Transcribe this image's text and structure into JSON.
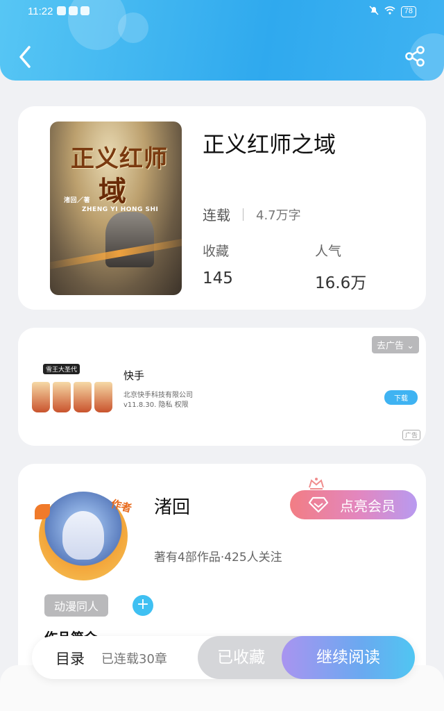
{
  "status_bar": {
    "time": "11:22",
    "battery": "78"
  },
  "book": {
    "title": "正义红师之域",
    "status": "连载",
    "word_count": "4.7万字",
    "favorites_label": "收藏",
    "favorites_value": "145",
    "popularity_label": "人气",
    "popularity_value": "16.6万",
    "cover": {
      "title_top": "正义红师",
      "title_bottom": "域",
      "pinyin": "ZHENG YI HONG SHI",
      "author_mark": "渚回／著"
    }
  },
  "ad": {
    "remove_label": "去广告",
    "app_name": "快手",
    "company": "北京快手科技有限公司",
    "version_line": "v11.8.30. 隐私  权限",
    "download_label": "下载",
    "ad_mark": "广告",
    "image_tag": "雪王大圣代"
  },
  "author": {
    "name": "渚回",
    "avatar_badge": "作者",
    "vip_label": "点亮会员",
    "info": "著有4部作品·425人关注",
    "tag": "动漫同人",
    "intro_heading": "作品简介"
  },
  "bottom_bar": {
    "toc_label": "目录",
    "chapters": "已连载30章",
    "favorited_label": "已收藏",
    "continue_label": "继续阅读"
  },
  "colors": {
    "accent": "#3fb3f2",
    "header": "#2fa9ee",
    "vip_start": "#f27d84",
    "vip_end": "#b89af0"
  }
}
